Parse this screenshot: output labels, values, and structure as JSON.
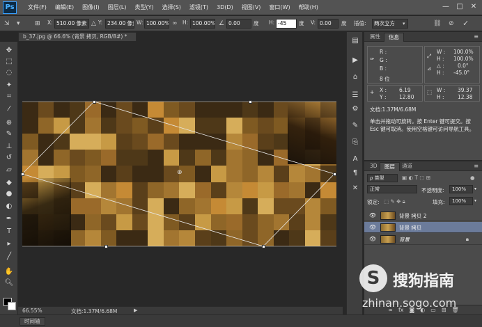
{
  "app": {
    "logo": "Ps"
  },
  "menubar": {
    "items": [
      "文件(F)",
      "编辑(E)",
      "图像(I)",
      "图层(L)",
      "类型(Y)",
      "选择(S)",
      "滤镜(T)",
      "3D(D)",
      "视图(V)",
      "窗口(W)",
      "帮助(H)"
    ],
    "controls": [
      "—",
      "□",
      "✕"
    ]
  },
  "options": {
    "x_label": "X:",
    "x_value": "510.00 像素",
    "y_label": "Y:",
    "y_value": "234.00 像素",
    "w_label": "W:",
    "w_value": "100.00%",
    "h_label": "H:",
    "h_value": "100.00%",
    "angle_value": "0.00",
    "angle_unit": "度",
    "hskew_label": "H:",
    "hskew_value": "-45",
    "hskew_unit": "度",
    "vskew_label": "V:",
    "vskew_value": "0.00",
    "vskew_unit": "度",
    "interp_label": "插值:",
    "interp_value": "两次立方"
  },
  "document": {
    "tab_title": "b_37.jpg @ 66.6% (背景 拷贝, RGB/8#) *"
  },
  "status": {
    "zoom": "66.55%",
    "doc": "文档:1.37M/6.68M"
  },
  "timeline": {
    "label": "时间轴"
  },
  "info_panel": {
    "tabs": [
      "属性",
      "信息"
    ],
    "active_tab": "信息",
    "r_label": "R :",
    "g_label": "G :",
    "b_label": "B :",
    "bits": "8 位",
    "w_label": "W :",
    "w_value": "100.0%",
    "h_label": "H :",
    "h_value": "100.0%",
    "angle_label": "△ :",
    "angle_value": "0.0°",
    "hskew_label": "H :",
    "hskew_value": "-45.0°",
    "x_label": "X :",
    "x_value": "6.19",
    "y_label": "Y :",
    "y_value": "12.80",
    "w2_label": "W :",
    "w2_value": "39.37",
    "h2_label": "H :",
    "h2_value": "12.38",
    "doc": "文档:1.37M/6.68M",
    "help": "单击并拖动可旋转。按 Enter 键可提交。按 Esc 键可取消。使用空格键可访问导航工具。"
  },
  "layers_panel": {
    "tabs": [
      "3D",
      "图层",
      "通道"
    ],
    "active_tab": "图层",
    "filter_value": "ρ 类型",
    "blend_mode": "正常",
    "opacity_label": "不透明度:",
    "opacity_value": "100%",
    "lock_label": "锁定:",
    "fill_label": "填充:",
    "fill_value": "100%",
    "layers": [
      {
        "name": "背景 拷贝 2",
        "selected": false,
        "locked": false
      },
      {
        "name": "背景 拷贝",
        "selected": true,
        "locked": false
      },
      {
        "name": "背景",
        "selected": false,
        "locked": true
      }
    ]
  },
  "watermark": {
    "logo": "S",
    "text": "搜狗指南",
    "url": "zhinan.sogo.com"
  },
  "colors": {
    "accent": "#3aa0ff",
    "selected_layer": "#6b7b9a"
  },
  "pixel_palette": [
    "#3b2a14",
    "#4e3818",
    "#6a4a1e",
    "#7f5a22",
    "#8f6628",
    "#a27530",
    "#b5873a",
    "#c79a45",
    "#d6ad5a",
    "#9a6a2a",
    "#5a3f1a",
    "#c58a35"
  ]
}
